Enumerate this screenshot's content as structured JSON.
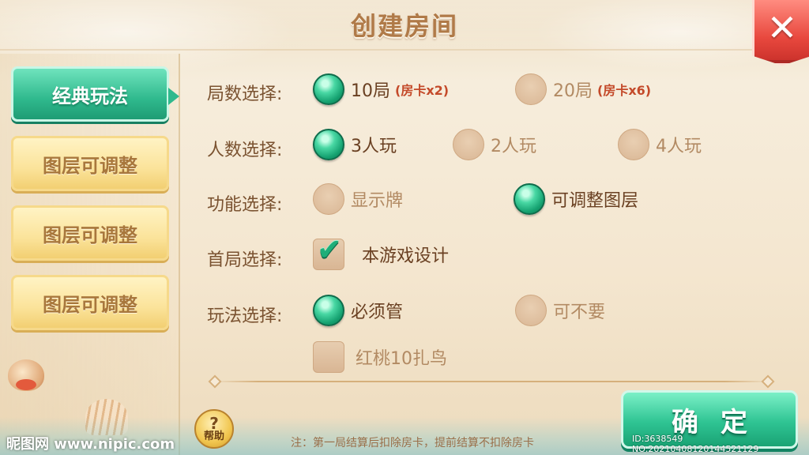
{
  "title": "创建房间",
  "close_label": "✕",
  "sidebar": {
    "items": [
      {
        "label": "经典玩法"
      },
      {
        "label": "图层可调整"
      },
      {
        "label": "图层可调整"
      },
      {
        "label": "图层可调整"
      }
    ]
  },
  "rounds": {
    "label": "局数选择:",
    "opt1": "10局",
    "opt1_sub": "(房卡x2)",
    "opt2": "20局",
    "opt2_sub": "(房卡x6)"
  },
  "players": {
    "label": "人数选择:",
    "opt1": "3人玩",
    "opt2": "2人玩",
    "opt3": "4人玩"
  },
  "features": {
    "label": "功能选择:",
    "opt1": "显示牌",
    "opt2": "可调整图层"
  },
  "first_round": {
    "label": "首局选择:",
    "opt1": "本游戏设计"
  },
  "gameplay": {
    "label": "玩法选择:",
    "opt1": "必须管",
    "opt2": "可不要",
    "opt3": "红桃10扎鸟"
  },
  "note": "注：第一局结算后扣除房卡，提前结算不扣除房卡",
  "help": {
    "symbol": "?",
    "label": "帮助"
  },
  "confirm_label": "确定",
  "watermark": "昵图网 www.nipic.com",
  "id_tag": "ID:3638549 NO:20210408120144521129"
}
